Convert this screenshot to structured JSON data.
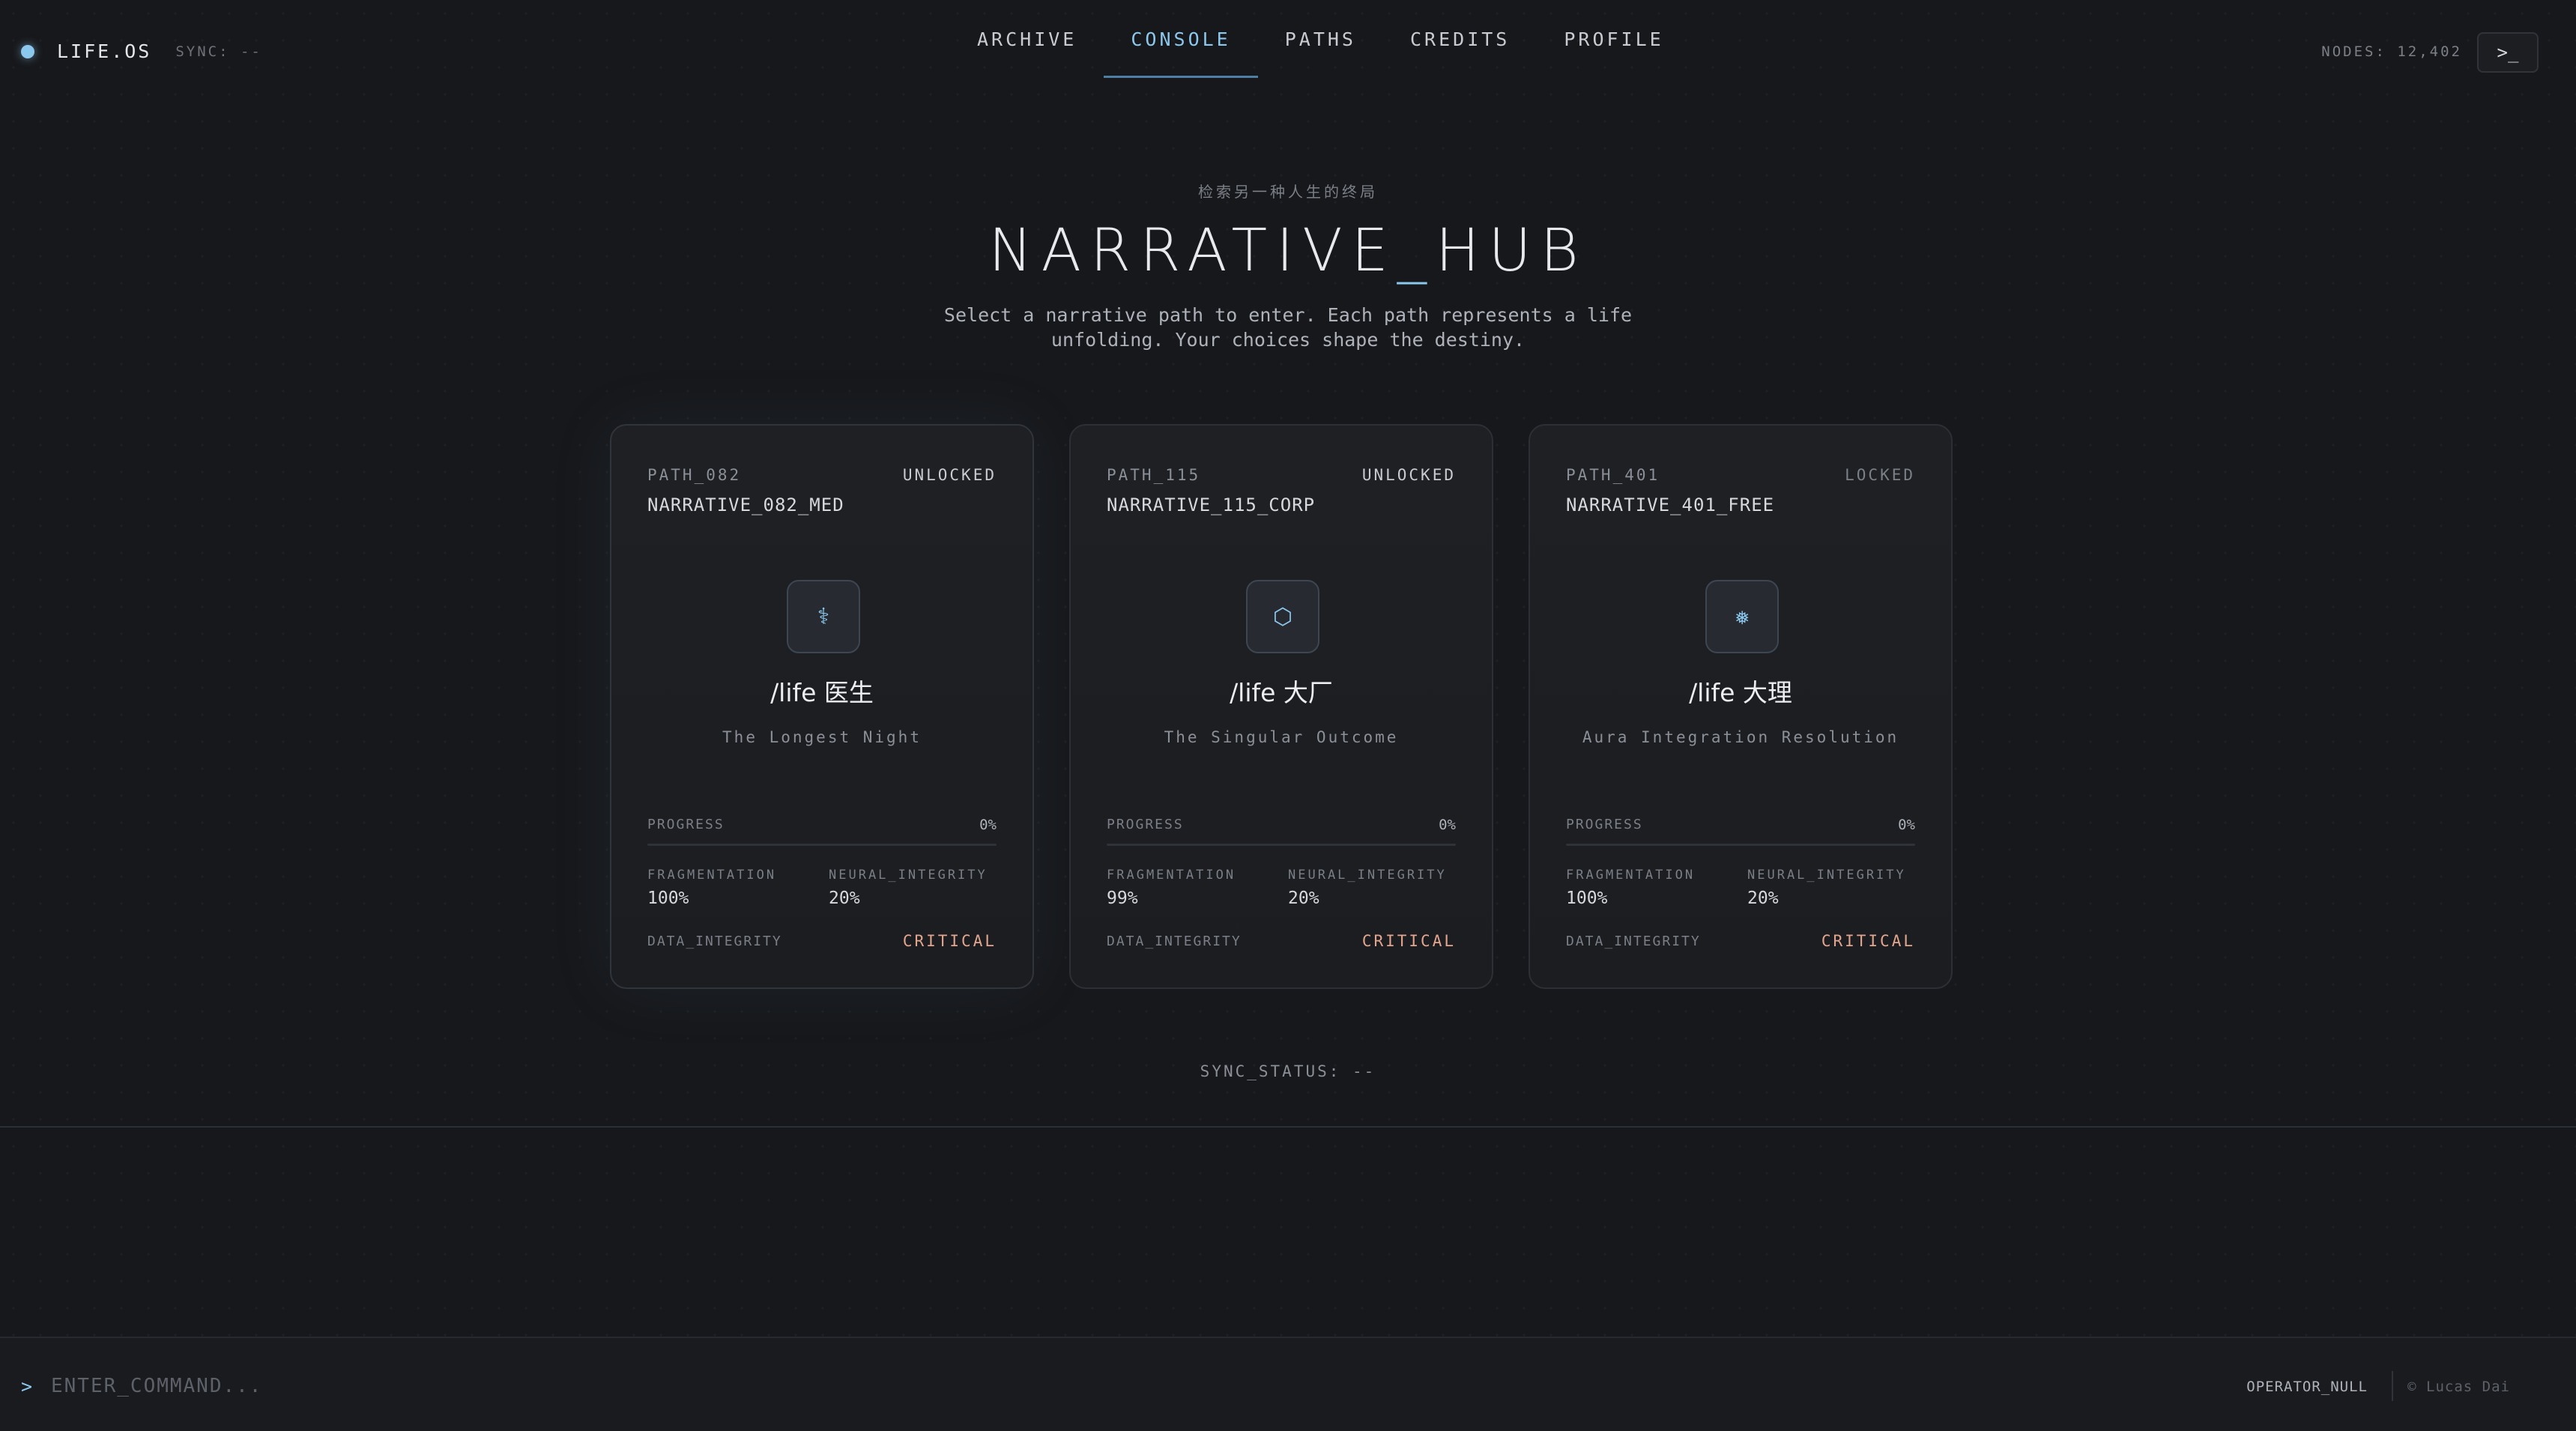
{
  "header": {
    "brand": "LIFE.OS",
    "sync": "SYNC: --",
    "nav": [
      {
        "label": "ARCHIVE",
        "active": false
      },
      {
        "label": "CONSOLE",
        "active": true
      },
      {
        "label": "PATHS",
        "active": false
      },
      {
        "label": "CREDITS",
        "active": false
      },
      {
        "label": "PROFILE",
        "active": false
      }
    ],
    "nodes": "NODES: 12,402",
    "terminal_button": ">_"
  },
  "hero": {
    "subtitle": "检索另一种人生的终局",
    "title_left": "NARRATIVE",
    "title_sep": "_",
    "title_right": "HUB",
    "description": "Select a narrative path to enter. Each path represents a life unfolding. Your choices shape the destiny."
  },
  "cards": [
    {
      "id": "PATH_082",
      "status": "UNLOCKED",
      "name": "NARRATIVE_082_MED",
      "icon": "⚕",
      "icon_name": "caduceus-icon",
      "life": "/life 医生",
      "tagline": "The Longest Night",
      "progress_label": "PROGRESS",
      "progress": "0%",
      "progress_fraction": 0,
      "frag_label": "FRAGMENTATION",
      "frag": "100%",
      "neural_label": "NEURAL_INTEGRITY",
      "neural": "20%",
      "di_label": "DATA_INTEGRITY",
      "di": "CRITICAL"
    },
    {
      "id": "PATH_115",
      "status": "UNLOCKED",
      "name": "NARRATIVE_115_CORP",
      "icon": "⬡",
      "icon_name": "hexagon-icon",
      "life": "/life 大厂",
      "tagline": "The Singular Outcome",
      "progress_label": "PROGRESS",
      "progress": "0%",
      "progress_fraction": 0,
      "frag_label": "FRAGMENTATION",
      "frag": "99%",
      "neural_label": "NEURAL_INTEGRITY",
      "neural": "20%",
      "di_label": "DATA_INTEGRITY",
      "di": "CRITICAL"
    },
    {
      "id": "PATH_401",
      "status": "LOCKED",
      "name": "NARRATIVE_401_FREE",
      "icon": "❅",
      "icon_name": "snowflake-icon",
      "life": "/life 大理",
      "tagline": "Aura Integration Resolution",
      "progress_label": "PROGRESS",
      "progress": "0%",
      "progress_fraction": 0,
      "frag_label": "FRAGMENTATION",
      "frag": "100%",
      "neural_label": "NEURAL_INTEGRITY",
      "neural": "20%",
      "di_label": "DATA_INTEGRITY",
      "di": "CRITICAL"
    }
  ],
  "sync_status": "SYNC_STATUS: --",
  "command_bar": {
    "prompt": ">",
    "placeholder": "ENTER_COMMAND...",
    "operator": "OPERATOR_NULL",
    "copyright": "© Lucas Dai"
  },
  "colors": {
    "accent": "#8cc8ee",
    "critical": "#e3a58e",
    "background": "#17181b"
  }
}
